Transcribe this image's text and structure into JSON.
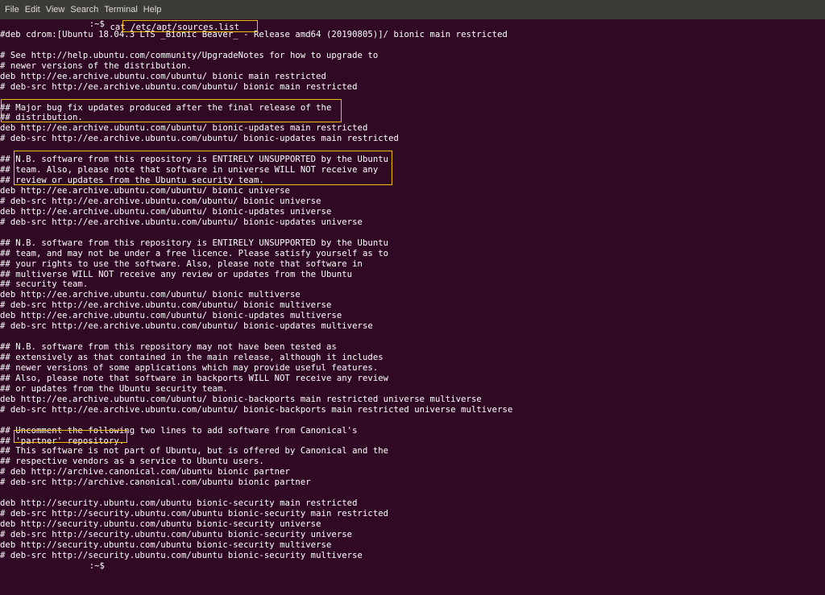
{
  "menu": [
    "File",
    "Edit",
    "View",
    "Search",
    "Terminal",
    "Help"
  ],
  "prompt": ":~$",
  "command": "cat /etc/apt/sources.list",
  "lines": [
    "#deb cdrom:[Ubuntu 18.04.3 LTS _Bionic Beaver_ - Release amd64 (20190805)]/ bionic main restricted",
    "",
    "# See http://help.ubuntu.com/community/UpgradeNotes for how to upgrade to",
    "# newer versions of the distribution.",
    "deb http://ee.archive.ubuntu.com/ubuntu/ bionic main restricted",
    "# deb-src http://ee.archive.ubuntu.com/ubuntu/ bionic main restricted",
    "",
    "## Major bug fix updates produced after the final release of the",
    "## distribution.",
    "deb http://ee.archive.ubuntu.com/ubuntu/ bionic-updates main restricted",
    "# deb-src http://ee.archive.ubuntu.com/ubuntu/ bionic-updates main restricted",
    "",
    "## N.B. software from this repository is ENTIRELY UNSUPPORTED by the Ubuntu",
    "## team. Also, please note that software in universe WILL NOT receive any",
    "## review or updates from the Ubuntu security team.",
    "deb http://ee.archive.ubuntu.com/ubuntu/ bionic universe",
    "# deb-src http://ee.archive.ubuntu.com/ubuntu/ bionic universe",
    "deb http://ee.archive.ubuntu.com/ubuntu/ bionic-updates universe",
    "# deb-src http://ee.archive.ubuntu.com/ubuntu/ bionic-updates universe",
    "",
    "## N.B. software from this repository is ENTIRELY UNSUPPORTED by the Ubuntu",
    "## team, and may not be under a free licence. Please satisfy yourself as to",
    "## your rights to use the software. Also, please note that software in",
    "## multiverse WILL NOT receive any review or updates from the Ubuntu",
    "## security team.",
    "deb http://ee.archive.ubuntu.com/ubuntu/ bionic multiverse",
    "# deb-src http://ee.archive.ubuntu.com/ubuntu/ bionic multiverse",
    "deb http://ee.archive.ubuntu.com/ubuntu/ bionic-updates multiverse",
    "# deb-src http://ee.archive.ubuntu.com/ubuntu/ bionic-updates multiverse",
    "",
    "## N.B. software from this repository may not have been tested as",
    "## extensively as that contained in the main release, although it includes",
    "## newer versions of some applications which may provide useful features.",
    "## Also, please note that software in backports WILL NOT receive any review",
    "## or updates from the Ubuntu security team.",
    "deb http://ee.archive.ubuntu.com/ubuntu/ bionic-backports main restricted universe multiverse",
    "# deb-src http://ee.archive.ubuntu.com/ubuntu/ bionic-backports main restricted universe multiverse",
    "",
    "## Uncomment the following two lines to add software from Canonical's",
    "## 'partner' repository.",
    "## This software is not part of Ubuntu, but is offered by Canonical and the",
    "## respective vendors as a service to Ubuntu users.",
    "# deb http://archive.canonical.com/ubuntu bionic partner",
    "# deb-src http://archive.canonical.com/ubuntu bionic partner",
    "",
    "deb http://security.ubuntu.com/ubuntu bionic-security main restricted",
    "# deb-src http://security.ubuntu.com/ubuntu bionic-security main restricted",
    "deb http://security.ubuntu.com/ubuntu bionic-security universe",
    "# deb-src http://security.ubuntu.com/ubuntu bionic-security universe",
    "deb http://security.ubuntu.com/ubuntu bionic-security multiverse",
    "# deb-src http://security.ubuntu.com/ubuntu bionic-security multiverse"
  ],
  "colors": {
    "terminal_bg": "#300a24",
    "menubar_bg": "#3c3b37",
    "text": "#ffffff",
    "highlight": "#f2b90f"
  }
}
